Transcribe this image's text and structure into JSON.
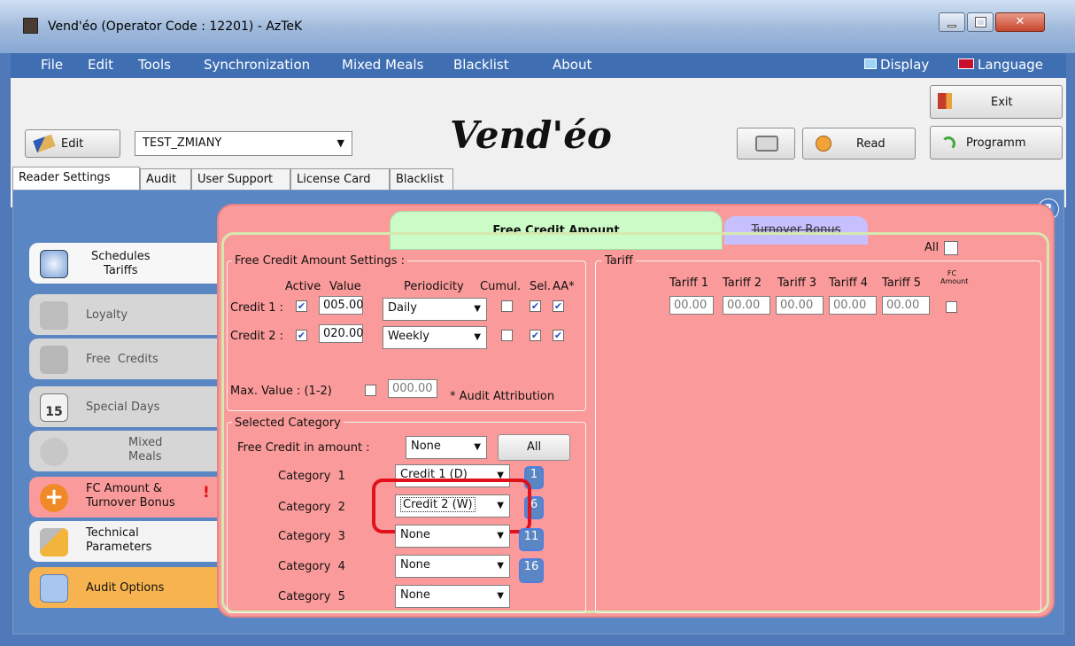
{
  "window": {
    "title": "Vend'éo (Operator Code : 12201) - AzTeK"
  },
  "menu": {
    "items": [
      "File",
      "Edit",
      "Tools",
      "Synchronization",
      "Mixed Meals",
      "Blacklist",
      "About"
    ],
    "display": "Display",
    "language": "Language"
  },
  "toolbar": {
    "edit_label": "Edit",
    "profile_value": "TEST_ZMIANY",
    "logo": "Vend'éo",
    "read_label": "Read",
    "exit_label": "Exit",
    "program_label": "Programm"
  },
  "tabs": [
    "Reader Settings",
    "Audit",
    "User Support",
    "License Card",
    "Blacklist"
  ],
  "sidebar": {
    "items": [
      {
        "label": "Schedules Tariffs",
        "line1": "Schedules",
        "line2": "Tariffs"
      },
      {
        "label": "Loyalty"
      },
      {
        "label": "Free Credits",
        "line1": "Free",
        "line2": "Credits"
      },
      {
        "label": "Special Days",
        "icon_text": "15"
      },
      {
        "label": "Mixed Meals",
        "line1": "Mixed",
        "line2": "Meals"
      },
      {
        "label": "FC Amount & Turnover Bonus",
        "line1": "FC Amount &",
        "line2": "Turnover Bonus",
        "warning": "!"
      },
      {
        "label": "Technical Parameters",
        "line1": "Technical",
        "line2": "Parameters"
      },
      {
        "label": "Audit Options"
      }
    ]
  },
  "panel": {
    "tab_active": "Free Credit Amount",
    "tab_inactive": "Turnover Bonus",
    "all_label": "All",
    "fca_settings": {
      "title": "Free Credit Amount Settings :",
      "headers": {
        "active": "Active",
        "value": "Value",
        "periodicity": "Periodicity",
        "cumul": "Cumul.",
        "sel": "Sel.",
        "aa": "AA*"
      },
      "rows": [
        {
          "label": "Credit 1 :",
          "value": "005.00",
          "periodicity": "Daily"
        },
        {
          "label": "Credit 2 :",
          "value": "020.00",
          "periodicity": "Weekly"
        }
      ],
      "max_label": "Max. Value : (1-2)",
      "max_value": "000.00",
      "audit_note": "* Audit Attribution"
    },
    "selected_category": {
      "title": "Selected Category",
      "fc_label": "Free Credit in amount :",
      "fc_value": "None",
      "all_button": "All",
      "rows": [
        {
          "label": "Category",
          "n": "1",
          "value": "Credit 1 (D)",
          "badge": "1"
        },
        {
          "label": "Category",
          "n": "2",
          "value": "Credit 2 (W)",
          "badge": "6"
        },
        {
          "label": "Category",
          "n": "3",
          "value": "None",
          "badge": "11"
        },
        {
          "label": "Category",
          "n": "4",
          "value": "None",
          "badge": "16"
        },
        {
          "label": "Category",
          "n": "5",
          "value": "None",
          "badge": ""
        }
      ]
    },
    "tariff": {
      "title": "Tariff",
      "headers": [
        "Tariff 1",
        "Tariff 2",
        "Tariff 3",
        "Tariff 4",
        "Tariff 5"
      ],
      "fc_header": "FC Amount",
      "values": [
        "00.00",
        "00.00",
        "00.00",
        "00.00",
        "00.00"
      ]
    }
  }
}
